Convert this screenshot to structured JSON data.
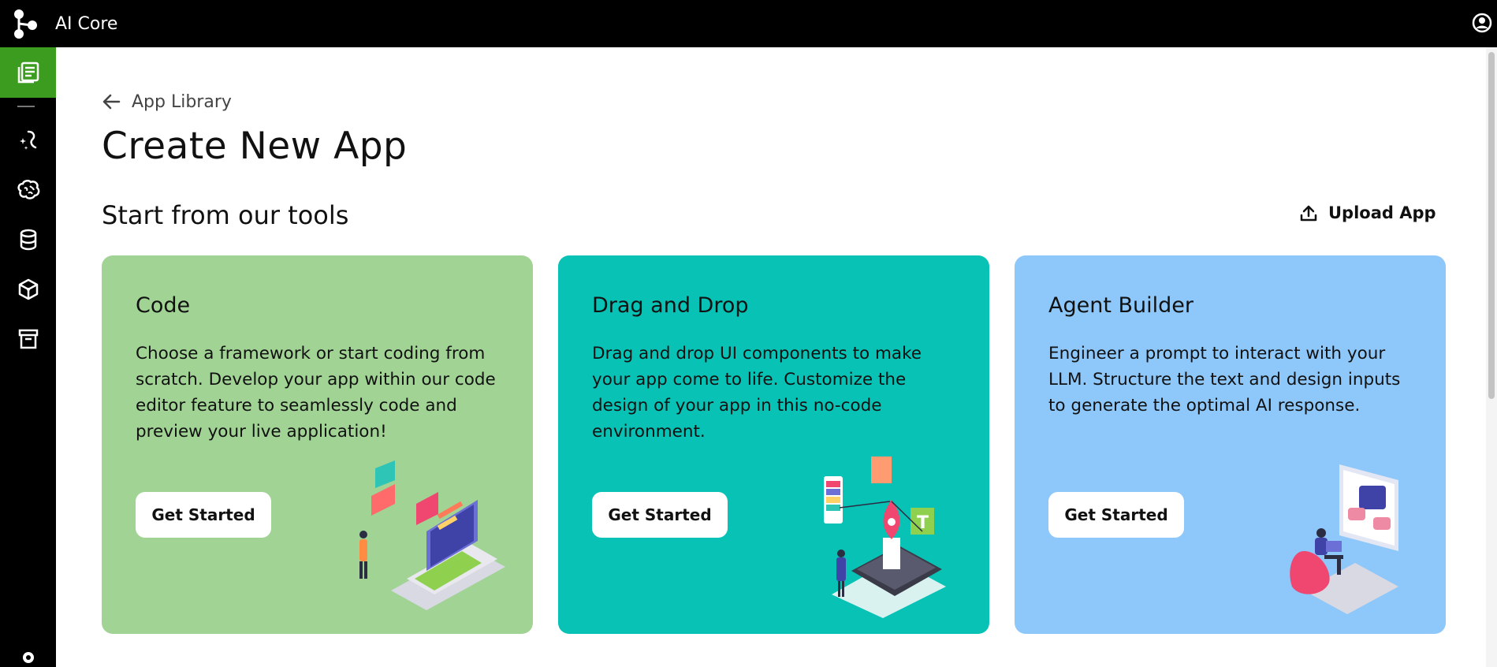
{
  "header": {
    "app_title": "AI Core"
  },
  "breadcrumb": {
    "label": "App Library"
  },
  "page": {
    "title": "Create New App",
    "section_title": "Start from our tools",
    "upload_label": "Upload App"
  },
  "cards": [
    {
      "title": "Code",
      "description": "Choose a framework or start coding from scratch. Develop your app within our code editor feature to seamlessly code and preview your live application!",
      "button": "Get Started",
      "color": "#a1d395"
    },
    {
      "title": "Drag and Drop",
      "description": "Drag and drop UI components to make your app come to life. Customize the design of your app in this no-code environment.",
      "button": "Get Started",
      "color": "#08c2b5"
    },
    {
      "title": "Agent Builder",
      "description": "Engineer a prompt to interact with your LLM. Structure the text and design inputs to generate the optimal AI response.",
      "button": "Get Started",
      "color": "#8ec8fb"
    }
  ],
  "sidebar": {
    "items": [
      {
        "icon": "app-library-icon",
        "active": true
      },
      {
        "icon": "prompt-icon"
      },
      {
        "icon": "model-brain-icon"
      },
      {
        "icon": "database-icon"
      },
      {
        "icon": "package-icon"
      },
      {
        "icon": "archive-icon"
      }
    ]
  },
  "colors": {
    "topbar": "#000000",
    "sidebar_active": "#3b9c1f"
  }
}
